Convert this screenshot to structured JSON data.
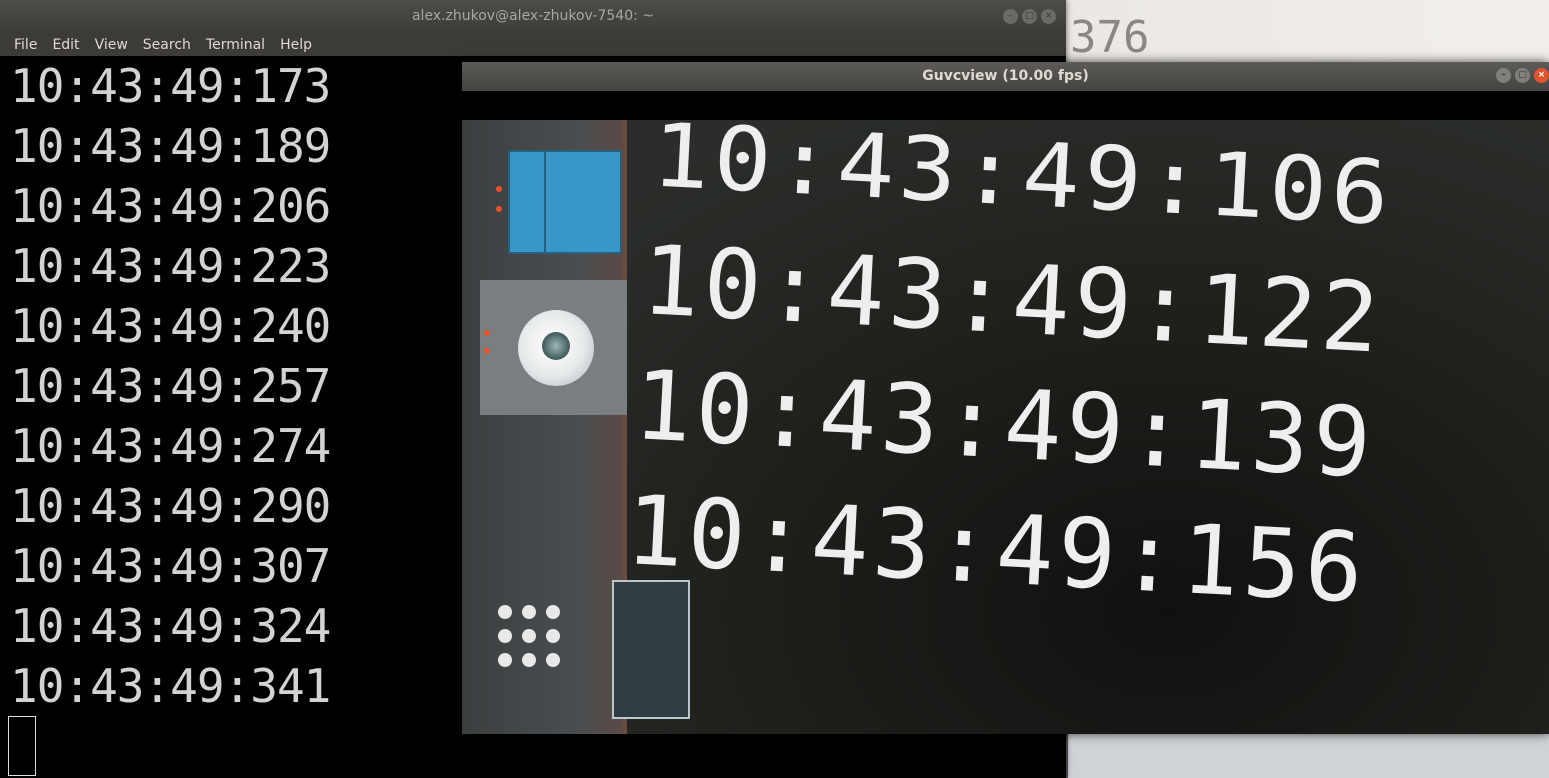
{
  "desktop": {
    "background_number": "376"
  },
  "terminal": {
    "title": "alex.zhukov@alex-zhukov-7540: ~",
    "menu": [
      "File",
      "Edit",
      "View",
      "Search",
      "Terminal",
      "Help"
    ],
    "lines": [
      "10:43:49:173",
      "10:43:49:189",
      "10:43:49:206",
      "10:43:49:223",
      "10:43:49:240",
      "10:43:49:257",
      "10:43:49:274",
      "10:43:49:290",
      "10:43:49:307",
      "10:43:49:324",
      "10:43:49:341"
    ]
  },
  "guvcview": {
    "title": "Guvcview  (10.00 fps)",
    "video_lines": [
      "10:43:49:106",
      "10:43:49:122",
      "10:43:49:139",
      "10:43:49:156"
    ]
  },
  "colors": {
    "accent_blue": "#3797c8",
    "close_orange": "#e0552f",
    "terminal_text": "#d3d3d3"
  }
}
